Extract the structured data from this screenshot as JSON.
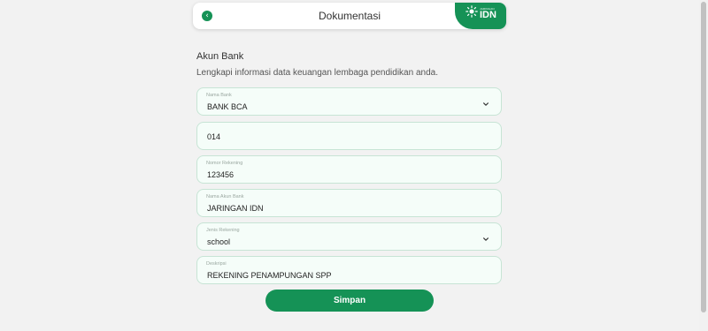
{
  "header": {
    "title": "Dokumentasi",
    "back_icon": "chevron-left-icon",
    "logo_small_text": "JARINGAN",
    "logo_text": "IDN"
  },
  "section": {
    "title": "Akun Bank",
    "subtitle": "Lengkapi informasi data keuangan lembaga pendidikan anda."
  },
  "fields": [
    {
      "label": "Nama Bank",
      "value": "BANK BCA",
      "type": "select"
    },
    {
      "label": "",
      "value": "014",
      "type": "text"
    },
    {
      "label": "Nomor Rekening",
      "value": "123456",
      "type": "text"
    },
    {
      "label": "Nama Akun Bank",
      "value": "JARINGAN IDN",
      "type": "text"
    },
    {
      "label": "Jenis Rekening",
      "value": "school",
      "type": "select"
    },
    {
      "label": "Deskripsi",
      "value": "REKENING PENAMPUNGAN SPP",
      "type": "text"
    }
  ],
  "save_label": "Simpan",
  "colors": {
    "primary": "#159256",
    "field_bg": "#f5fdf9",
    "field_border": "#c7e4d5",
    "page_bg": "#f2f2f2"
  }
}
